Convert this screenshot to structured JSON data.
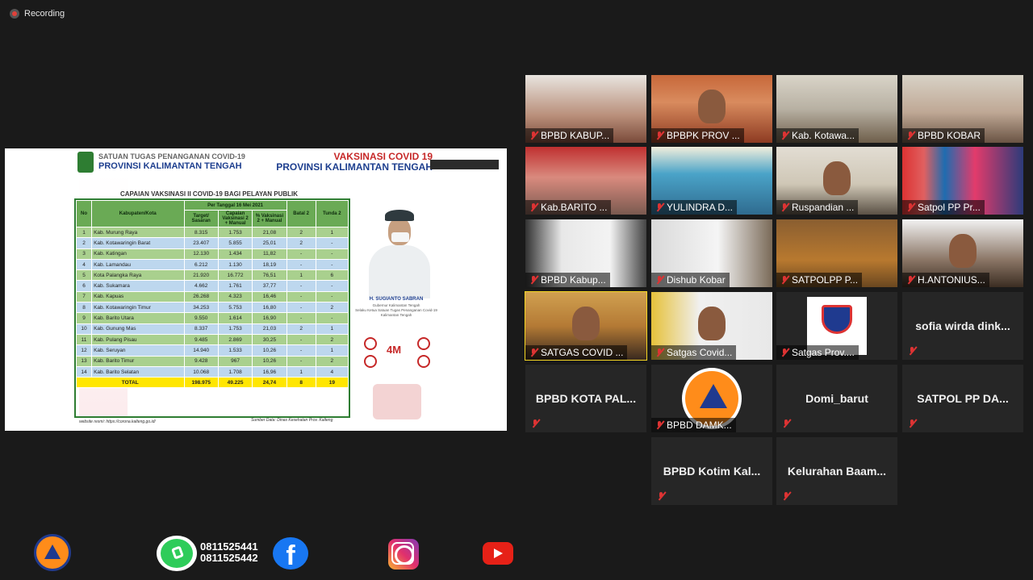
{
  "recording_label": "Recording",
  "slide": {
    "header_left_line1": "SATUAN TUGAS PENANGANAN COVID-19",
    "header_left_line2": "PROVINSI KALIMANTAN TENGAH",
    "header_right_line1": "VAKSINASI COVID 19",
    "header_right_line2": "PROVINSI KALIMANTAN TENGAH",
    "table_title": "CAPAIAN VAKSINASI II COVID-19 BAGI PELAYAN PUBLIK",
    "date_header": "Per Tanggal 16 Mei 2021",
    "columns": [
      "No",
      "Kabupaten/Kota",
      "Target/ Sasaran",
      "Capaian Vaksinasi 2 + Manual",
      "% Vaksinasi 2 + Manual",
      "Batal 2",
      "Tunda 2"
    ],
    "rows": [
      [
        "1",
        "Kab. Murung Raya",
        "8.315",
        "1.753",
        "21,08",
        "2",
        "1"
      ],
      [
        "2",
        "Kab. Kotawaringin Barat",
        "23.407",
        "5.855",
        "25,01",
        "2",
        "-"
      ],
      [
        "3",
        "Kab. Katingan",
        "12.130",
        "1.434",
        "11,82",
        "-",
        "-"
      ],
      [
        "4",
        "Kab. Lamandau",
        "6.212",
        "1.130",
        "18,19",
        "-",
        "-"
      ],
      [
        "5",
        "Kota Palangka Raya",
        "21.920",
        "16.772",
        "76,51",
        "1",
        "6"
      ],
      [
        "6",
        "Kab. Sukamara",
        "4.662",
        "1.761",
        "37,77",
        "-",
        "-"
      ],
      [
        "7",
        "Kab. Kapuas",
        "26.268",
        "4.323",
        "16,46",
        "-",
        "-"
      ],
      [
        "8",
        "Kab. Kotawaringin Timur",
        "34.253",
        "5.753",
        "16,80",
        "-",
        "2"
      ],
      [
        "9",
        "Kab. Barito Utara",
        "9.550",
        "1.614",
        "16,90",
        "-",
        "-"
      ],
      [
        "10",
        "Kab. Gunung Mas",
        "8.337",
        "1.753",
        "21,03",
        "2",
        "1"
      ],
      [
        "11",
        "Kab. Pulang Pisau",
        "9.485",
        "2.869",
        "30,25",
        "-",
        "2"
      ],
      [
        "12",
        "Kab. Seruyan",
        "14.940",
        "1.533",
        "10,26",
        "-",
        "1"
      ],
      [
        "13",
        "Kab. Barito Timur",
        "9.428",
        "967",
        "10,26",
        "-",
        "2"
      ],
      [
        "14",
        "Kab. Barito Selatan",
        "10.068",
        "1.708",
        "16,96",
        "1",
        "4"
      ]
    ],
    "total": [
      "TOTAL",
      "198.975",
      "49.225",
      "24,74",
      "8",
      "19"
    ],
    "governor_name": "H. SUGIANTO SABRAN",
    "governor_role1": "Gubernur Kalimantan Tengah",
    "governor_role2": "Selaku Ketua Satuan Tugas Penanganan Covid-19 Kalimantan Tengah",
    "m4_label": "4M",
    "website": "website resmi: https://corona.kalteng.go.id/",
    "source": "Sumber Data: Dinas Kesehatan Prov. Kalteng"
  },
  "participants": [
    {
      "name": "BPBD KABUP..."
    },
    {
      "name": "BPBPK PROV ..."
    },
    {
      "name": "Kab. Kotawa..."
    },
    {
      "name": "BPBD KOBAR"
    },
    {
      "name": "Kab.BARITO ..."
    },
    {
      "name": "YULINDRA D..."
    },
    {
      "name": "Ruspandian ..."
    },
    {
      "name": "Satpol PP Pr..."
    },
    {
      "name": "BPBD Kabup..."
    },
    {
      "name": "Dishub Kobar"
    },
    {
      "name": "SATPOLPP P..."
    },
    {
      "name": "H.ANTONIUS..."
    },
    {
      "name": "SATGAS COVID ..."
    },
    {
      "name": "Satgas Covid..."
    },
    {
      "name": "Satgas Prov...."
    },
    {
      "name": "sofia wirda dink..."
    },
    {
      "name": "BPBD KOTA PAL..."
    },
    {
      "name": "BPBD DAMK..."
    },
    {
      "name": "Domi_barut"
    },
    {
      "name": "SATPOL PP DA..."
    },
    {
      "name": "BPBD Kotim Kal..."
    },
    {
      "name": "Kelurahan Baam..."
    }
  ],
  "footer": {
    "phone1": "0811525441",
    "phone2": "0811525442"
  }
}
